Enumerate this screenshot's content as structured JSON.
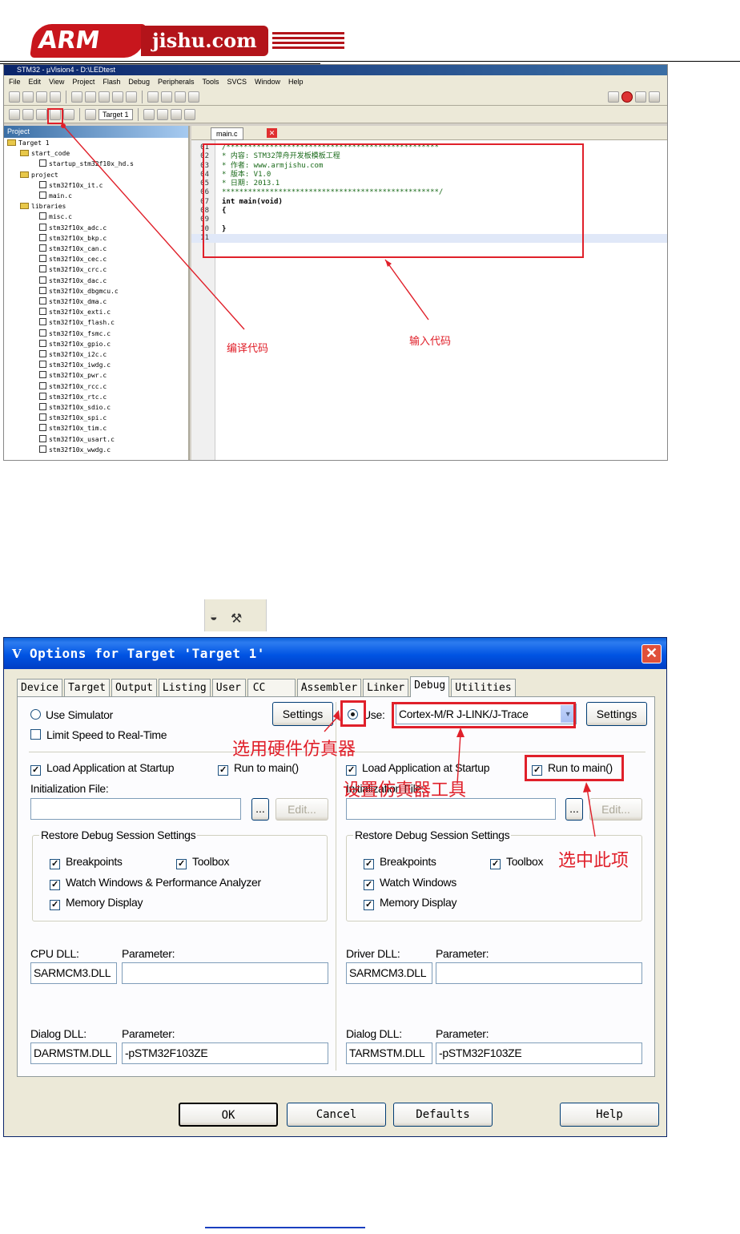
{
  "logo": {
    "brand": "ARM",
    "site": "jishu.com"
  },
  "ide": {
    "title": "STM32 - µVision4 - D:\\LEDtest",
    "menu": [
      "File",
      "Edit",
      "View",
      "Project",
      "Flash",
      "Debug",
      "Peripherals",
      "Tools",
      "SVCS",
      "Window",
      "Help"
    ],
    "target_select": "Target 1",
    "project_header": "Project",
    "tree": [
      "Target 1",
      "start_code",
      "startup_stm32f10x_hd.s",
      "project",
      "stm32f10x_it.c",
      "main.c",
      "libraries",
      "misc.c",
      "stm32f10x_adc.c",
      "stm32f10x_bkp.c",
      "stm32f10x_can.c",
      "stm32f10x_cec.c",
      "stm32f10x_crc.c",
      "stm32f10x_dac.c",
      "stm32f10x_dbgmcu.c",
      "stm32f10x_dma.c",
      "stm32f10x_exti.c",
      "stm32f10x_flash.c",
      "stm32f10x_fsmc.c",
      "stm32f10x_gpio.c",
      "stm32f10x_i2c.c",
      "stm32f10x_iwdg.c",
      "stm32f10x_pwr.c",
      "stm32f10x_rcc.c",
      "stm32f10x_rtc.c",
      "stm32f10x_sdio.c",
      "stm32f10x_spi.c",
      "stm32f10x_tim.c",
      "stm32f10x_usart.c",
      "stm32f10x_wwdg.c"
    ],
    "editor_tab": "main.c",
    "code": [
      {
        "n": "01",
        "t": "/*************************************************"
      },
      {
        "n": "02",
        "t": "* 内容: STM32萍舟开发板模板工程"
      },
      {
        "n": "03",
        "t": "* 作者: www.armjishu.com"
      },
      {
        "n": "04",
        "t": "* 版本: V1.0"
      },
      {
        "n": "05",
        "t": "* 日期: 2013.1"
      },
      {
        "n": "06",
        "t": "**************************************************/"
      },
      {
        "n": "07",
        "t": "int main(void)"
      },
      {
        "n": "08",
        "t": "{"
      },
      {
        "n": "09",
        "t": ""
      },
      {
        "n": "10",
        "t": "}"
      },
      {
        "n": "11",
        "t": ""
      }
    ],
    "annotation_compile": "编译代码",
    "annotation_input": "输入代码"
  },
  "dialog": {
    "title": "Options for Target 'Target 1'",
    "close": "✕",
    "tabs": [
      "Device",
      "Target",
      "Output",
      "Listing",
      "User",
      "CC",
      "Assembler",
      "Linker",
      "Debug",
      "Utilities"
    ],
    "active_tab": "Debug",
    "left": {
      "use_simulator": "Use Simulator",
      "limit_speed": "Limit Speed to Real-Time",
      "settings": "Settings",
      "load_app": "Load Application at Startup",
      "run_to_main": "Run to main()",
      "init_file": "Initialization File:",
      "browse": "...",
      "edit": "Edit...",
      "restore_group": "Restore Debug Session Settings",
      "breakpoints": "Breakpoints",
      "toolbox": "Toolbox",
      "watch_windows": "Watch Windows & Performance Analyzer",
      "memory_display": "Memory Display",
      "cpu_dll": "CPU DLL:",
      "parameter": "Parameter:",
      "cpu_dll_value": "SARMCM3.DLL",
      "cpu_param_value": "",
      "dialog_dll": "Dialog DLL:",
      "dialog_dll_value": "DARMSTM.DLL",
      "dialog_param_value": "-pSTM32F103ZE"
    },
    "right": {
      "use": "Use:",
      "driver": "Cortex-M/R J-LINK/J-Trace",
      "settings": "Settings",
      "load_app": "Load Application at Startup",
      "run_to_main": "Run to main()",
      "init_file": "Initialization File:",
      "browse": "...",
      "edit": "Edit...",
      "restore_group": "Restore Debug Session Settings",
      "breakpoints": "Breakpoints",
      "toolbox": "Toolbox",
      "watch_windows": "Watch Windows",
      "memory_display": "Memory Display",
      "driver_dll": "Driver DLL:",
      "parameter": "Parameter:",
      "driver_dll_value": "SARMCM3.DLL",
      "driver_param_value": "",
      "dialog_dll": "Dialog DLL:",
      "dialog_dll_value": "TARMSTM.DLL",
      "dialog_param_value": "-pSTM32F103ZE"
    },
    "buttons": {
      "ok": "OK",
      "cancel": "Cancel",
      "defaults": "Defaults",
      "help": "Help"
    },
    "annotations": {
      "select_hardware": "选用硬件仿真器",
      "set_tool": "设置仿真器工具",
      "check_item": "选中此项"
    },
    "checkmark": "✓"
  },
  "colors": {
    "annotation_red": "#e0202a",
    "xp_blue": "#0054e3",
    "dialog_bg": "#ece9d8"
  }
}
